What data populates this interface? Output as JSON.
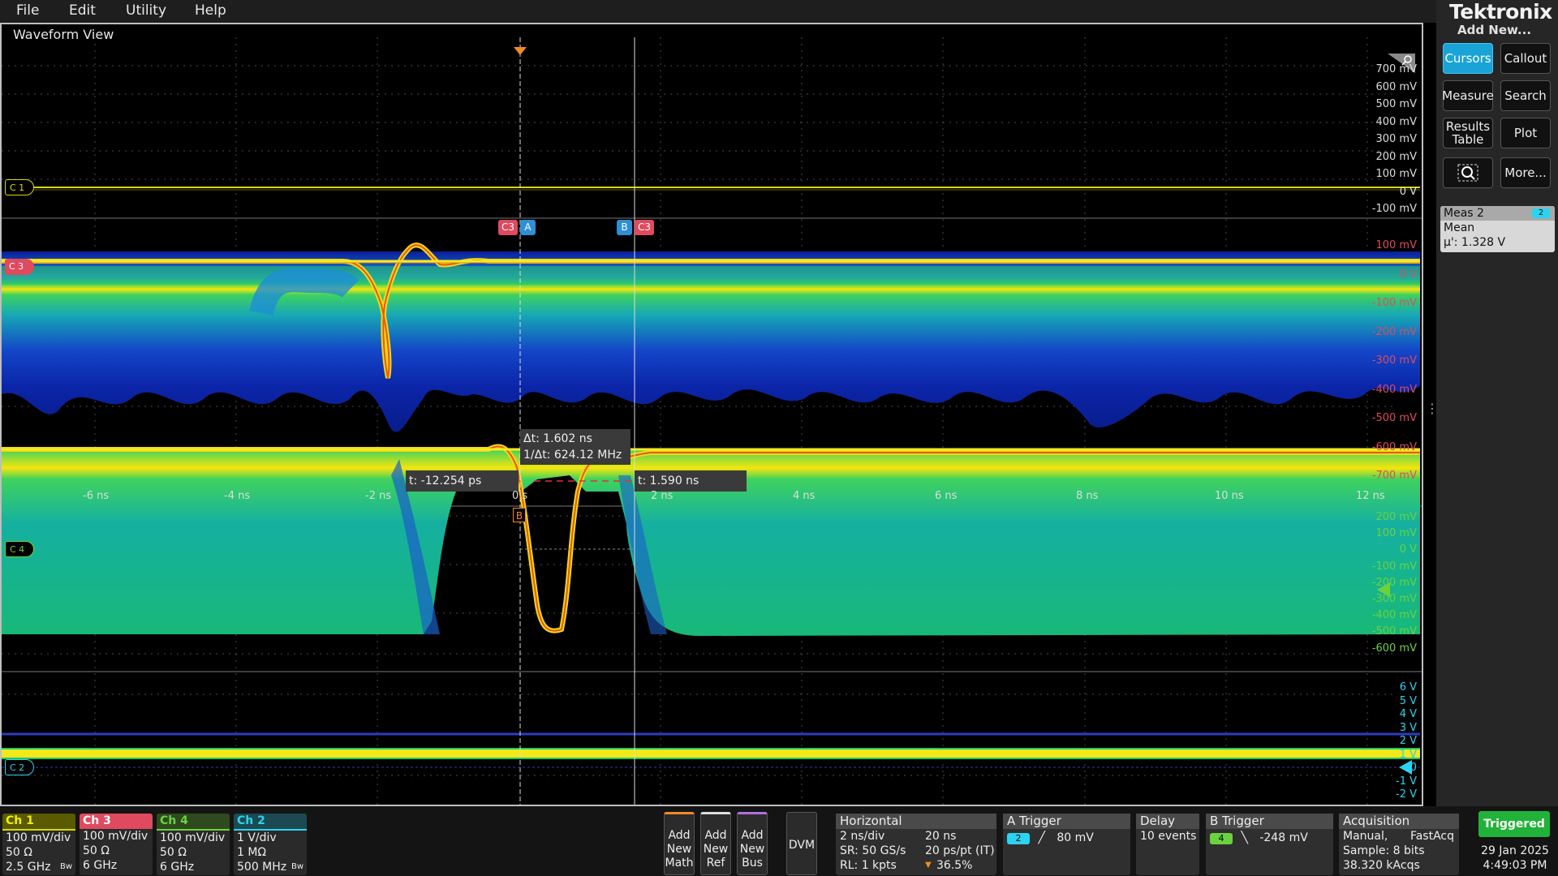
{
  "menu": {
    "file": "File",
    "edit": "Edit",
    "utility": "Utility",
    "help": "Help"
  },
  "brand": {
    "logo": "Tektronix",
    "add_new": "Add New..."
  },
  "buttons": {
    "cursors": "Cursors",
    "callout": "Callout",
    "measure": "Measure",
    "search": "Search",
    "results_table_1": "Results",
    "results_table_2": "Table",
    "plot": "Plot",
    "zoom_icon": "zoom-region-icon",
    "more": "More..."
  },
  "meas_badge": {
    "title": "Meas 2",
    "source": "2",
    "stat": "Mean",
    "value": "µ': 1.328 V"
  },
  "waveform_view": {
    "title": "Waveform View"
  },
  "colors": {
    "ch1": "#e8e800",
    "ch2": "#2ad4f0",
    "ch3": "#f0566e",
    "ch4": "#6bd23e",
    "accent": "#1aa3d6",
    "triggered": "#21b23a"
  },
  "ch1_axis": {
    "labels": [
      "700 mV",
      "600 mV",
      "500 mV",
      "400 mV",
      "300 mV",
      "200 mV",
      "100 mV",
      "0 V",
      "-100 mV"
    ],
    "marker": "C 1"
  },
  "ch3_axis": {
    "labels": [
      "100 mV",
      "0 V",
      "-100 mV",
      "-200 mV",
      "-300 mV",
      "-400 mV",
      "-500 mV",
      "-600 mV",
      "-700 mV"
    ],
    "marker": "C 3"
  },
  "ch4_axis": {
    "labels": [
      "200 mV",
      "100 mV",
      "0 V",
      "-100 mV",
      "-200 mV",
      "-300 mV",
      "-400 mV",
      "-500 mV",
      "-600 mV"
    ],
    "marker": "C 4"
  },
  "ch2_axis": {
    "labels": [
      "6 V",
      "5 V",
      "4 V",
      "3 V",
      "2 V",
      "1 V",
      "0",
      "-1 V",
      "-2 V"
    ],
    "marker": "C 2"
  },
  "time_axis": {
    "labels": [
      "-6 ns",
      "-4 ns",
      "-2 ns",
      "0 s",
      "2 ns",
      "4 ns",
      "6 ns",
      "8 ns",
      "10 ns",
      "12 ns"
    ]
  },
  "cursors": {
    "tag_c3": "C3",
    "tag_a": "A",
    "tag_b": "B",
    "trigger_b": "B",
    "delta_t": "Δt: 1.602 ns",
    "inv_delta_t": "1/Δt: 624.12 MHz",
    "t_a": "t: -12.254 ps",
    "t_b": "t: 1.590 ns"
  },
  "channels": [
    {
      "name": "Ch 1",
      "line1": "100 mV/div",
      "line2": "50 Ω",
      "line3": "2.5 GHz",
      "bw": "Bw"
    },
    {
      "name": "Ch 3",
      "line1": "100 mV/div",
      "line2": "50 Ω",
      "line3": "6 GHz"
    },
    {
      "name": "Ch 4",
      "line1": "100 mV/div",
      "line2": "50 Ω",
      "line3": "6 GHz"
    },
    {
      "name": "Ch 2",
      "line1": "1 V/div",
      "line2": "1 MΩ",
      "line3": "500 MHz",
      "bw": "Bw"
    }
  ],
  "add": {
    "math": [
      "Add",
      "New",
      "Math"
    ],
    "ref": [
      "Add",
      "New",
      "Ref"
    ],
    "bus": [
      "Add",
      "New",
      "Bus"
    ],
    "dvm": "DVM"
  },
  "horizontal": {
    "title": "Horizontal",
    "scale": "2 ns/div",
    "duration": "20 ns",
    "sr": "SR: 50 GS/s",
    "res": "20 ps/pt (IT)",
    "rl": "RL: 1 kpts",
    "pos": "36.5%"
  },
  "a_trigger": {
    "title": "A Trigger",
    "source": "2",
    "level": "80 mV"
  },
  "delay": {
    "title": "Delay",
    "value": "10 events"
  },
  "b_trigger": {
    "title": "B Trigger",
    "source": "4",
    "level": "-248 mV"
  },
  "acquisition": {
    "title": "Acquisition",
    "mode": "Manual,",
    "type": "FastAcq",
    "sample": "Sample: 8 bits",
    "rate": "38.320 kAcqs"
  },
  "status": {
    "triggered": "Triggered",
    "date": "29 Jan 2025",
    "time": "4:49:03 PM"
  }
}
